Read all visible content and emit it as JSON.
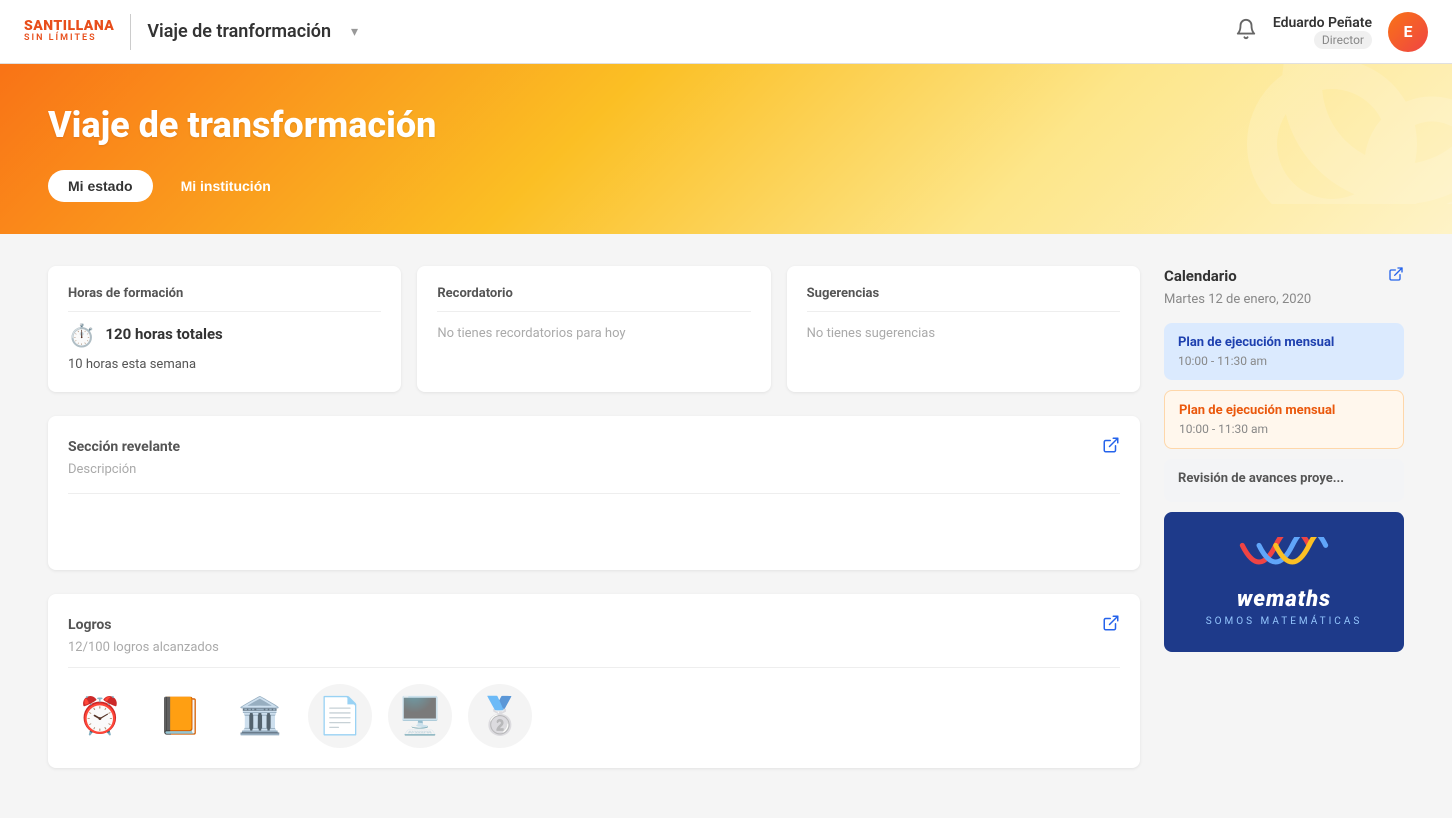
{
  "navbar": {
    "brand_top": "SANTILLANA",
    "brand_bottom": "SIN LÍMITES",
    "title": "Viaje de tranformación",
    "chevron": "▾",
    "bell": "🔔",
    "user_name": "Eduardo Peñate",
    "user_role": "Director",
    "avatar_letter": "E"
  },
  "hero": {
    "title": "Viaje de transformación",
    "tab_active": "Mi estado",
    "tab_inactive": "Mi institución"
  },
  "horas": {
    "title": "Horas de formación",
    "total": "120 horas totales",
    "week": "10 horas esta semana"
  },
  "recordatorio": {
    "title": "Recordatorio",
    "empty": "No tienes recordatorios para hoy"
  },
  "sugerencias": {
    "title": "Sugerencias",
    "empty": "No tienes sugerencias"
  },
  "seccion": {
    "title": "Sección revelante",
    "description": "Descripción"
  },
  "logros": {
    "title": "Logros",
    "count": "12/100 logros alcanzados"
  },
  "calendar": {
    "title": "Calendario",
    "date": "Martes 12 de enero, 2020",
    "events": [
      {
        "type": "blue",
        "title": "Plan de ejecución mensual",
        "time": "10:00 - 11:30 am"
      },
      {
        "type": "orange",
        "title": "Plan de ejecución mensual",
        "time": "10:00 - 11:30 am"
      },
      {
        "type": "gray",
        "title": "Revisión de avances proye...",
        "time": ""
      }
    ]
  },
  "wemaths": {
    "name": "wemaths",
    "tagline": "SOMOS MATEMÁTICAS"
  }
}
